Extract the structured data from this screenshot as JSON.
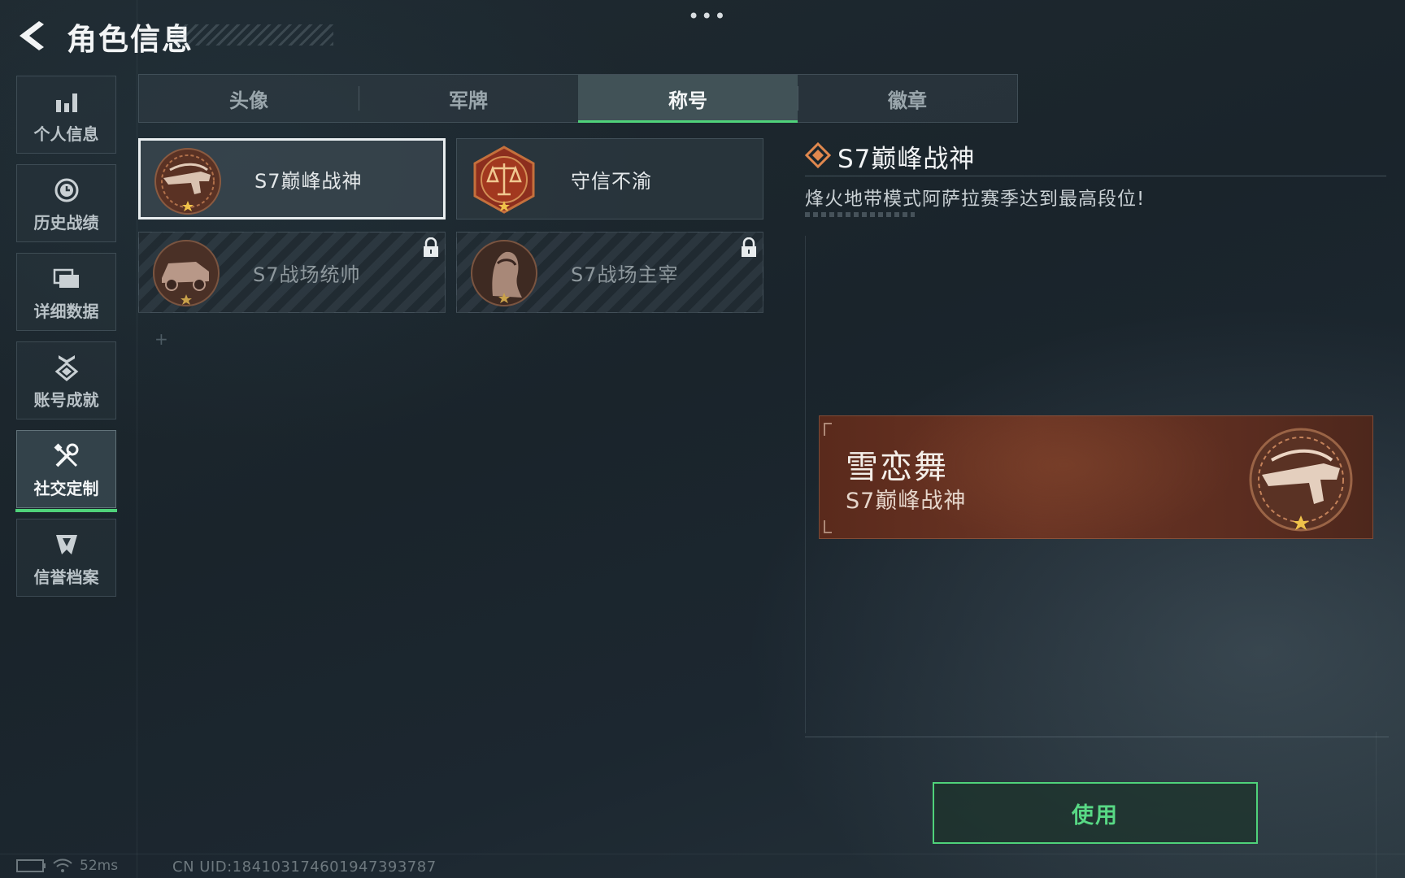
{
  "header": {
    "title": "角色信息",
    "more_label": "•••"
  },
  "sidebar": {
    "items": [
      {
        "label": "个人信息",
        "icon": "bar-chart-icon",
        "active": false
      },
      {
        "label": "历史战绩",
        "icon": "history-clock-icon",
        "active": false
      },
      {
        "label": "详细数据",
        "icon": "folder-icon",
        "active": false
      },
      {
        "label": "账号成就",
        "icon": "achievement-medal-icon",
        "active": false
      },
      {
        "label": "社交定制",
        "icon": "tools-icon",
        "active": true
      },
      {
        "label": "信誉档案",
        "icon": "shield-badge-icon",
        "active": false
      }
    ]
  },
  "tabs": [
    {
      "label": "头像",
      "active": false
    },
    {
      "label": "军牌",
      "active": false
    },
    {
      "label": "称号",
      "active": true
    },
    {
      "label": "徽章",
      "active": false
    }
  ],
  "titles": [
    {
      "name": "S7巅峰战神",
      "icon": "rifle-emblem-icon",
      "selected": true,
      "locked": false
    },
    {
      "name": "守信不渝",
      "icon": "scales-emblem-icon",
      "selected": false,
      "locked": false
    },
    {
      "name": "S7战场统帅",
      "icon": "vehicle-emblem-icon",
      "selected": false,
      "locked": true
    },
    {
      "name": "S7战场主宰",
      "icon": "soldier-portrait-emblem-icon",
      "selected": false,
      "locked": true
    }
  ],
  "detail": {
    "title": "S7巅峰战神",
    "description": "烽火地带模式阿萨拉赛季达到最高段位!"
  },
  "preview": {
    "player_name": "雪恋舞",
    "title": "S7巅峰战神"
  },
  "actions": {
    "use_label": "使用"
  },
  "footer": {
    "ping": "52ms",
    "uid": "CN UID:184103174601947393787"
  },
  "colors": {
    "accent_green": "#4fd27a",
    "nameplate_brown": "#5a2a1c",
    "badge_bronze": "#b0704a",
    "diamond_orange": "#e0884e"
  }
}
